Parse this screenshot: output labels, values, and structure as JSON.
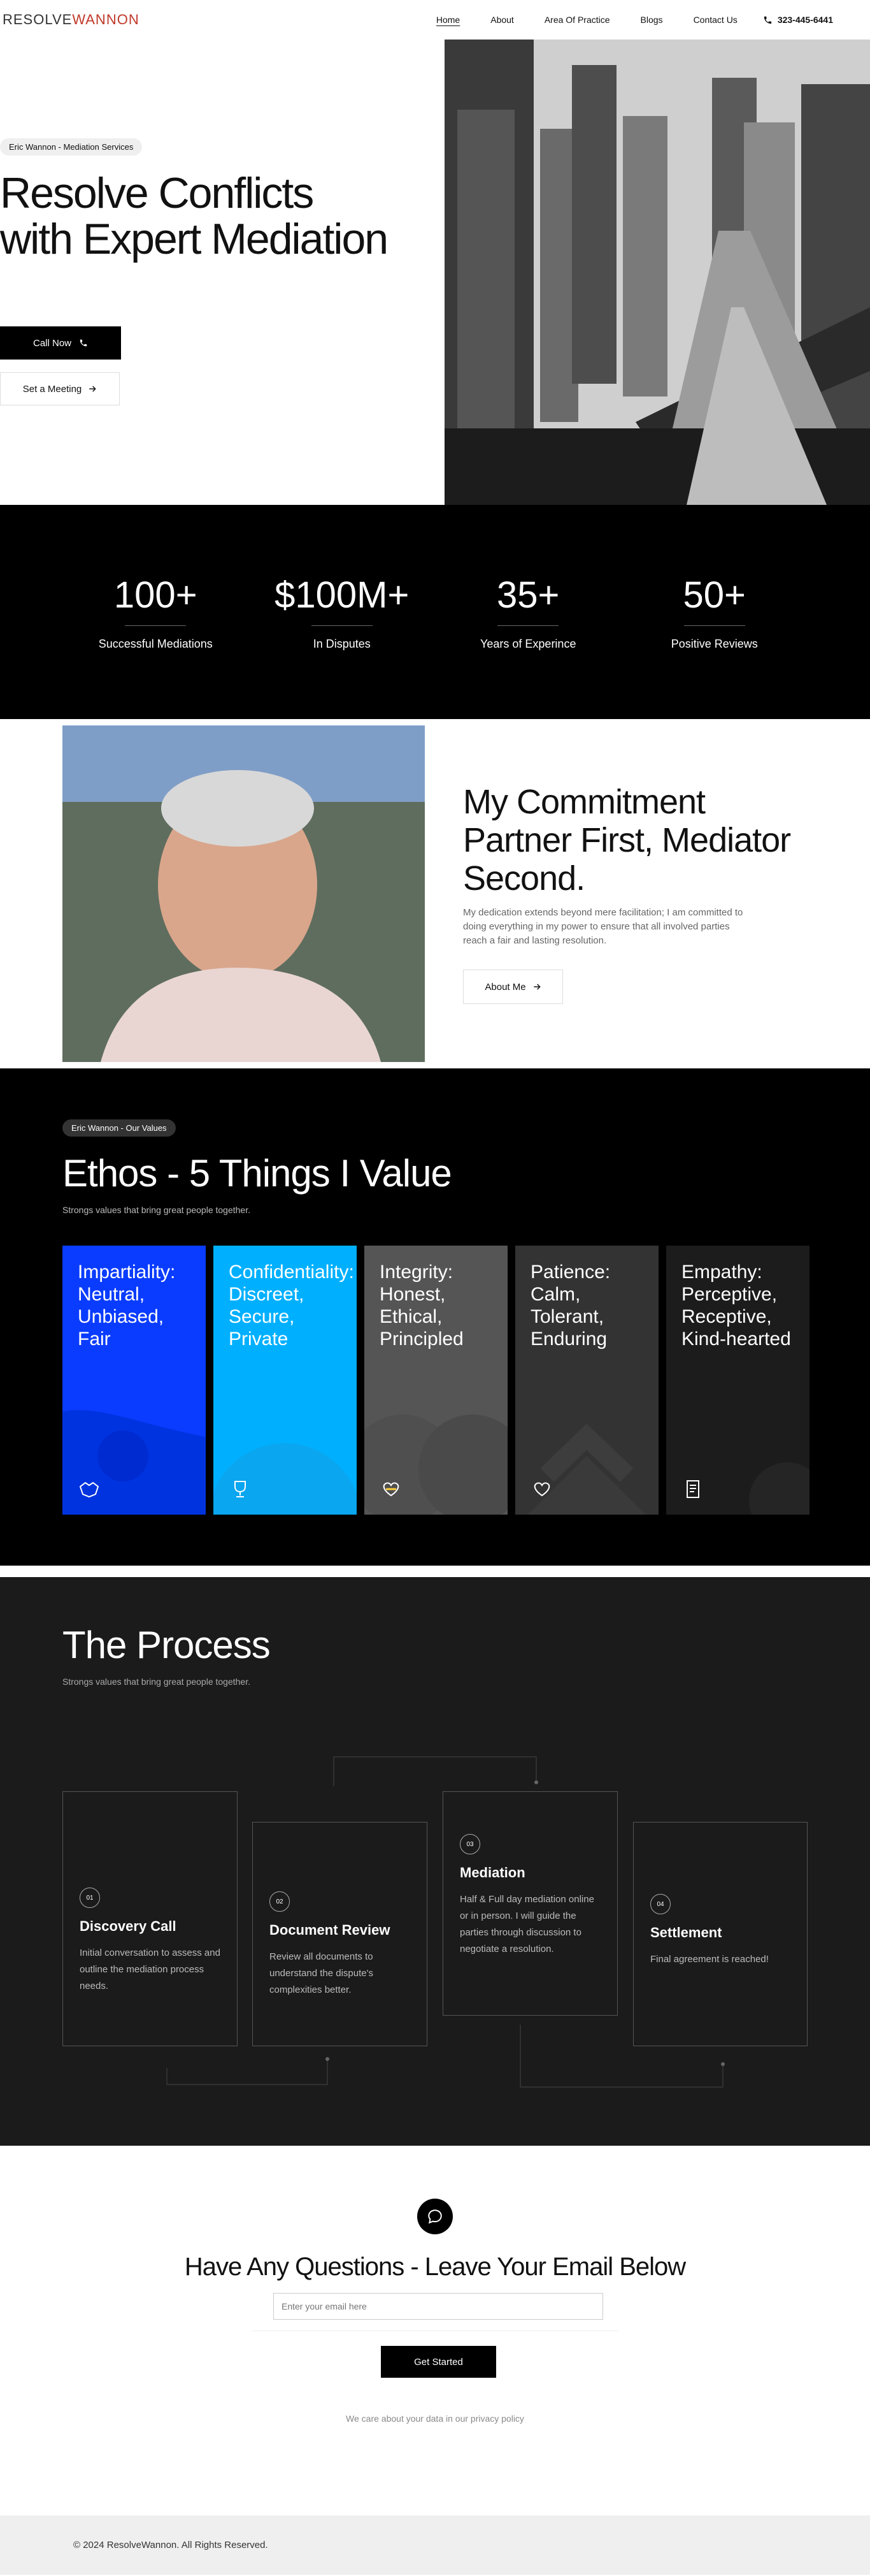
{
  "nav": {
    "logo_part1": "RESOLVE",
    "logo_part2": "WANNON",
    "links": [
      "Home",
      "About",
      "Area Of Practice",
      "Blogs",
      "Contact Us"
    ],
    "phone": "323-445-6441"
  },
  "hero": {
    "tag": "Eric Wannon - Mediation Services",
    "title": "Resolve Conflicts with Expert Mediation",
    "call_label": "Call Now",
    "meeting_label": "Set a Meeting"
  },
  "stats": [
    {
      "value": "100+",
      "label": "Successful Mediations"
    },
    {
      "value": "$100M+",
      "label": "In Disputes"
    },
    {
      "value": "35+",
      "label": "Years of Experince"
    },
    {
      "value": "50+",
      "label": "Positive Reviews"
    }
  ],
  "commitment": {
    "title": "My Commitment Partner First, Mediator Second.",
    "text": "My dedication extends beyond mere facilitation; I am committed to doing everything in my power to ensure that all involved parties reach a fair and lasting resolution.",
    "button": "About Me"
  },
  "ethos": {
    "tag": "Eric Wannon - Our Values",
    "title": "Ethos - 5 Things I Value",
    "subtitle": "Strongs values that bring great people together.",
    "cards": [
      {
        "title": "Impartiality: Neutral, Unbiased, Fair",
        "icon": "handshake-icon",
        "color": "#0a3cff"
      },
      {
        "title": "Confidentiality: Discreet, Secure, Private",
        "icon": "trophy-icon",
        "color": "#00b0ff"
      },
      {
        "title": "Integrity: Honest, Ethical, Principled",
        "icon": "heart-hands-icon",
        "color": "#555555"
      },
      {
        "title": "Patience: Calm, Tolerant, Enduring",
        "icon": "heart-hand-icon",
        "color": "#333333"
      },
      {
        "title": "Empathy: Perceptive, Receptive, Kind-hearted",
        "icon": "book-icon",
        "color": "#1c1c1c"
      }
    ]
  },
  "process": {
    "title": "The Process",
    "subtitle": "Strongs values that bring great people together.",
    "steps": [
      {
        "num": "01",
        "title": "Discovery Call",
        "text": "Initial conversation to assess and outline the mediation process needs."
      },
      {
        "num": "02",
        "title": "Document Review",
        "text": "Review all documents to understand the dispute's complexities better."
      },
      {
        "num": "03",
        "title": "Mediation",
        "text": "Half & Full day mediation online or in person. I will guide the parties through discussion to negotiate a resolution."
      },
      {
        "num": "04",
        "title": "Settlement",
        "text": "Final agreement is reached!"
      }
    ]
  },
  "questions": {
    "title": "Have Any Questions - Leave Your Email Below",
    "placeholder": "Enter your email here",
    "button": "Get Started",
    "note": "We care about your data in our privacy policy"
  },
  "footer": {
    "copyright": "© 2024 ResolveWannon. All Rights Reserved."
  }
}
